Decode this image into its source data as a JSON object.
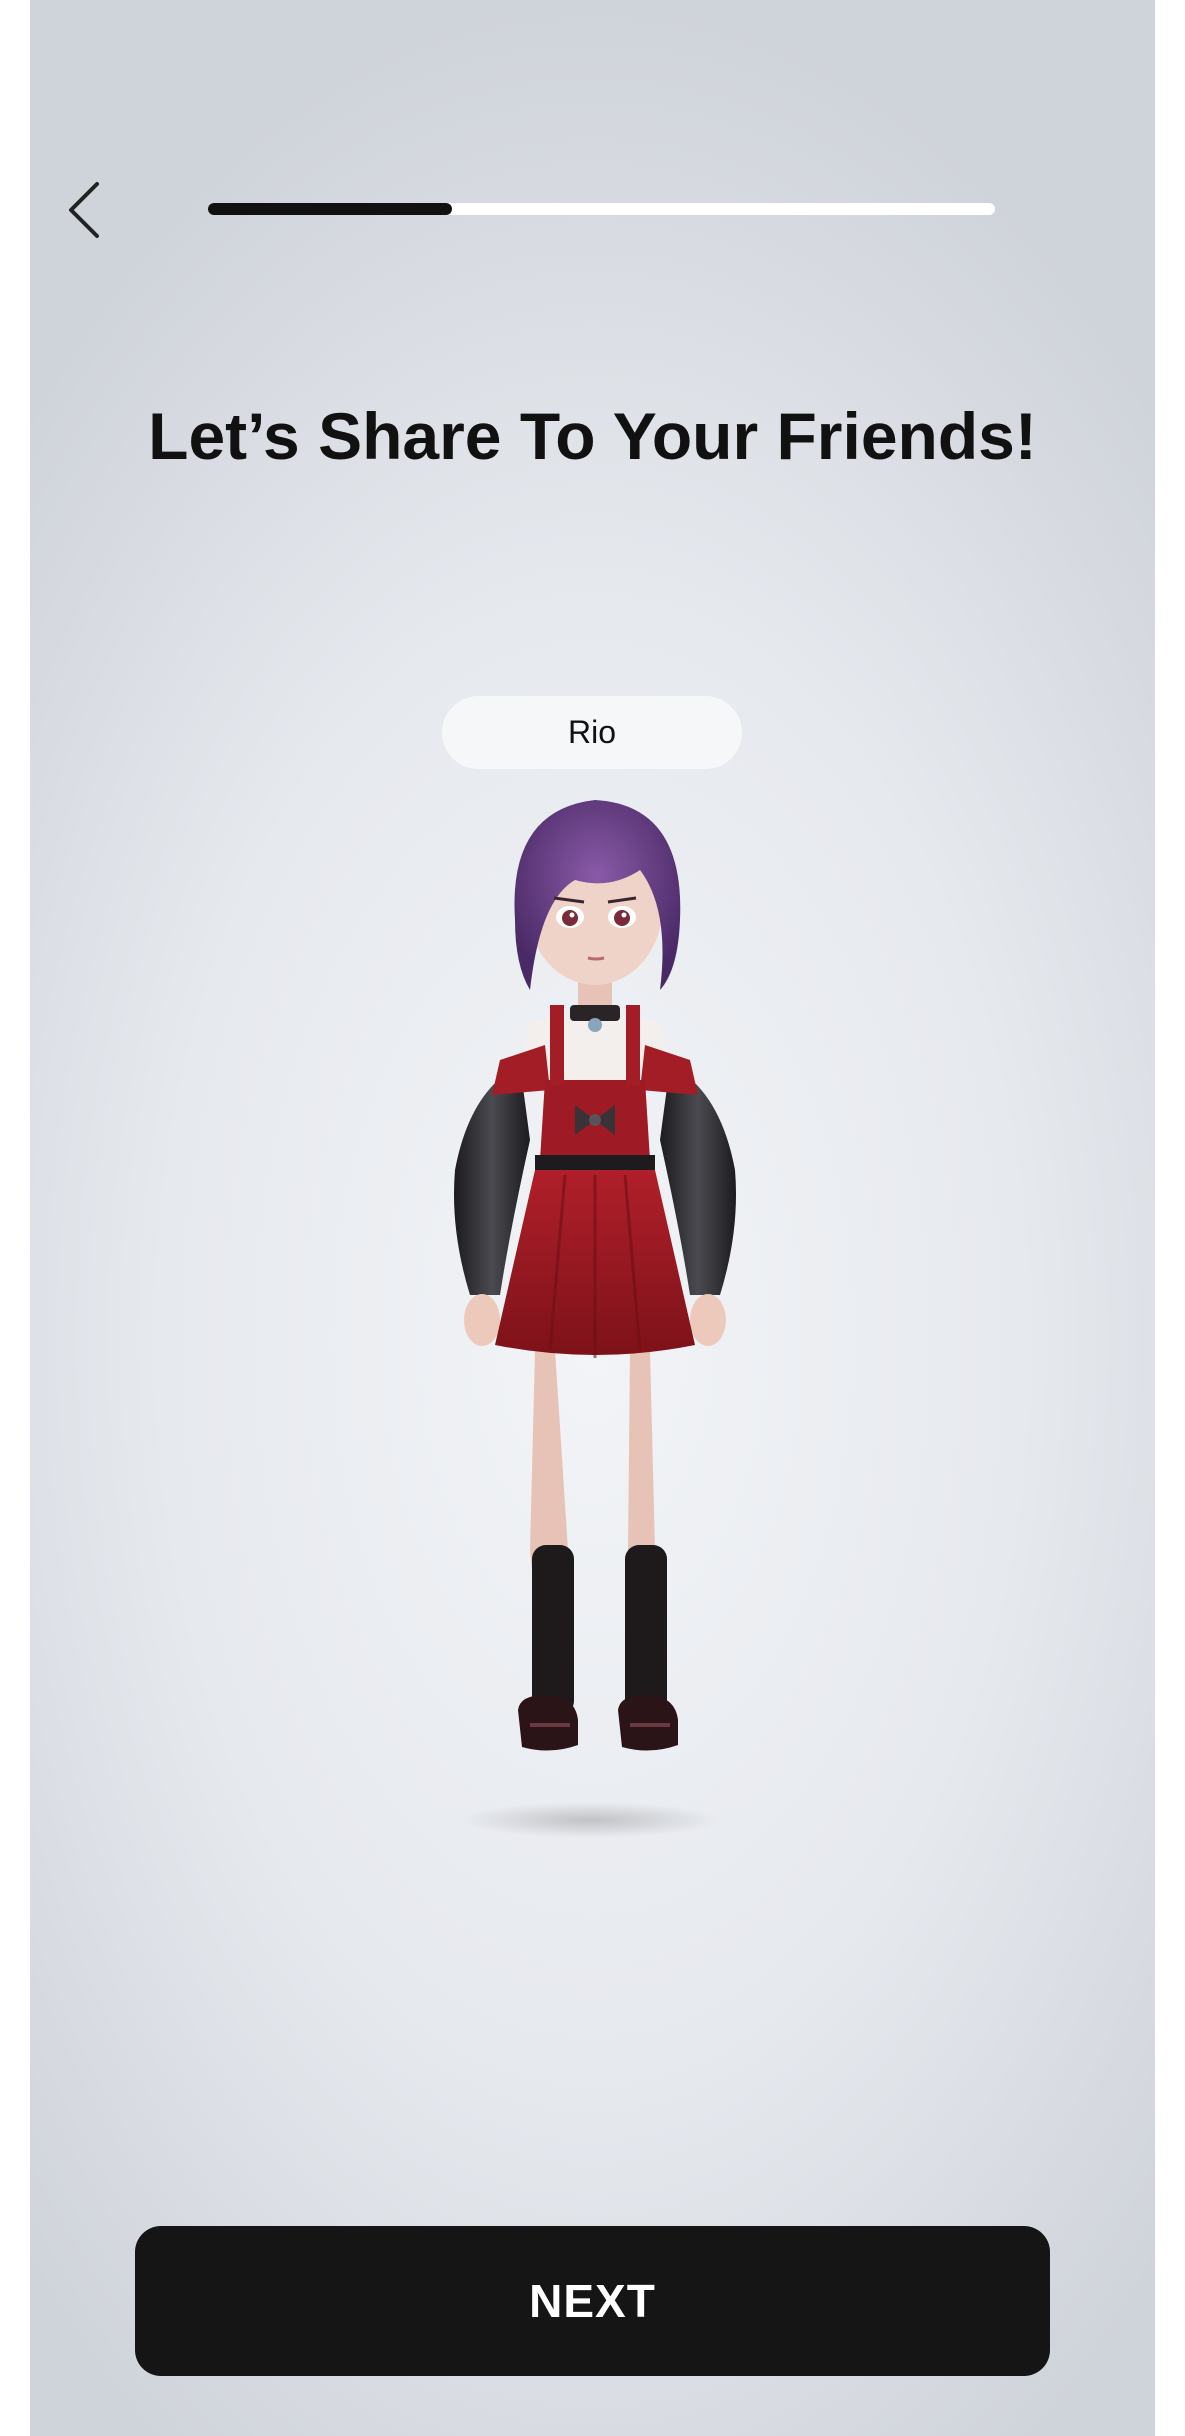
{
  "header": {
    "back_icon": "chevron-left-icon",
    "progress_fraction": 0.31
  },
  "title": "Let’s Share To Your Friends!",
  "character": {
    "name": "Rio"
  },
  "footer": {
    "next_label": "NEXT"
  },
  "colors": {
    "primary": "#151515",
    "progress_fill": "#111111",
    "progress_track": "#ffffff",
    "pill_background": "#f6f7f9"
  }
}
